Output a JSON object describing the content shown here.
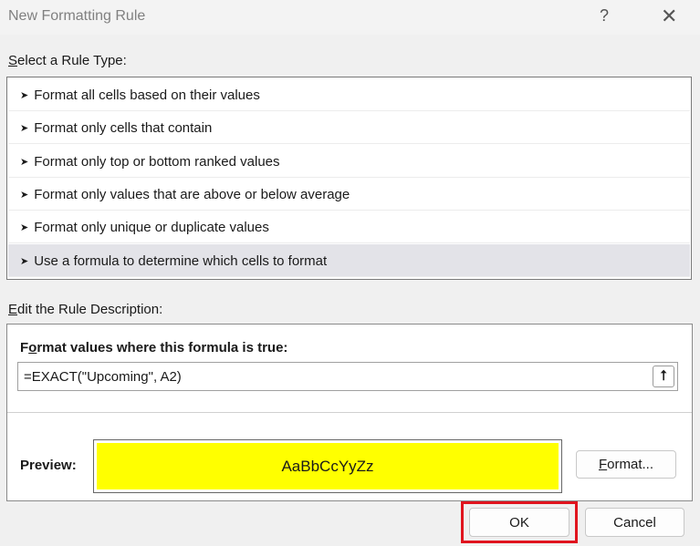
{
  "title": "New Formatting Rule",
  "help": "?",
  "close": "✕",
  "rule_type_label": {
    "first": "S",
    "rest": "elect a Rule Type:"
  },
  "rules": [
    "Format all cells based on their values",
    "Format only cells that contain",
    "Format only top or bottom ranked values",
    "Format only values that are above or below average",
    "Format only unique or duplicate values",
    "Use a formula to determine which cells to format"
  ],
  "selected_rule_index": 5,
  "edit_label": {
    "first": "E",
    "rest": "dit the Rule Description:"
  },
  "formula_label": {
    "a": "F",
    "b": "o",
    "c": "rmat values where this formula is true:"
  },
  "formula_value": "=EXACT(\"Upcoming\", A2)",
  "collapse_icon": "⭡",
  "preview_label": "Preview:",
  "preview_text": "AaBbCcYyZz",
  "preview_color": "#ffff00",
  "format_button": {
    "first": "F",
    "rest": "ormat..."
  },
  "ok": "OK",
  "cancel": "Cancel",
  "arrow": "➤"
}
